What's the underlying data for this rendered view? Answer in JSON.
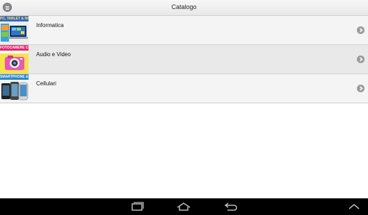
{
  "header": {
    "title": "Catalogo",
    "menu_icon": "menu-icon"
  },
  "catalog": {
    "items": [
      {
        "label": "Informatica",
        "thumb_caption": "PC, TABLET & NOTEBOOK",
        "thumb_icon": "laptop-tablet-image"
      },
      {
        "label": "Audio e Video",
        "thumb_caption": "FOTOCAMERE COMPATTE",
        "thumb_icon": "camera-image"
      },
      {
        "label": "Cellulari",
        "thumb_caption": "SMARTPHONE & CELLULARI",
        "thumb_icon": "smartphones-image"
      }
    ],
    "chevron_icon": "chevron-right-icon"
  },
  "system_nav": {
    "buttons": [
      "recent-apps-icon",
      "home-icon",
      "back-icon",
      "expand-up-icon"
    ]
  },
  "colors": {
    "topbar": "#ececec",
    "row_odd": "#f4f4f4",
    "row_even": "#e9e9e9",
    "navbar": "#000000"
  }
}
